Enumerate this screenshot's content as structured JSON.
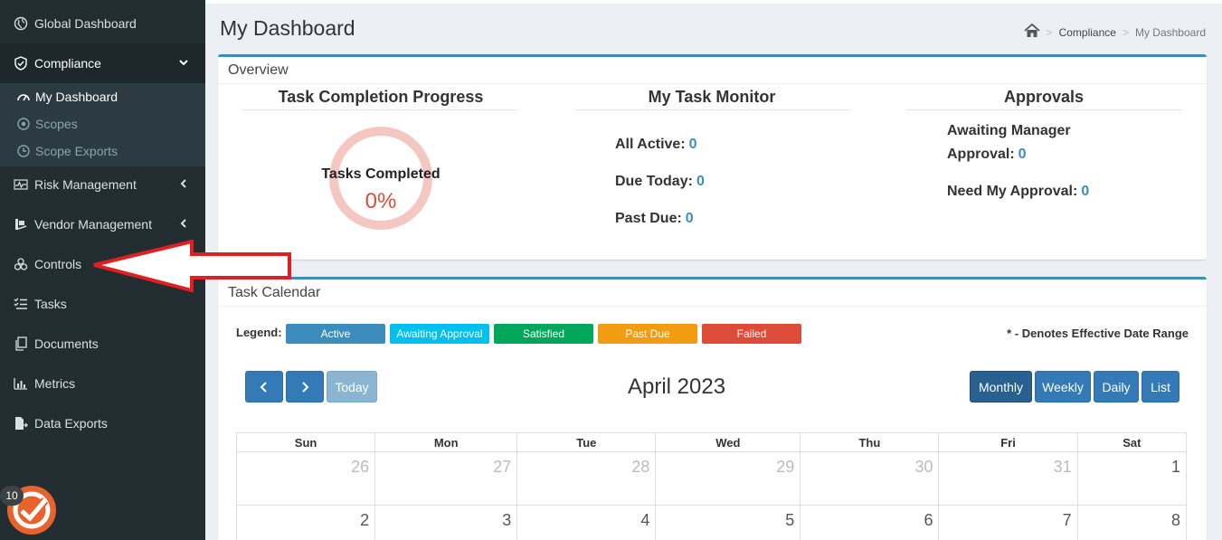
{
  "sidebar": {
    "global_dashboard": "Global Dashboard",
    "compliance": "Compliance",
    "sub": {
      "my_dashboard": "My Dashboard",
      "scopes": "Scopes",
      "scope_exports": "Scope Exports"
    },
    "risk_management": "Risk Management",
    "vendor_management": "Vendor Management",
    "controls": "Controls",
    "tasks": "Tasks",
    "documents": "Documents",
    "metrics": "Metrics",
    "data_exports": "Data Exports",
    "badge": "10"
  },
  "header": {
    "title": "My Dashboard",
    "breadcrumb": [
      "Compliance",
      "My Dashboard"
    ]
  },
  "overview": {
    "title": "Overview",
    "progress": {
      "title": "Task Completion Progress",
      "label": "Tasks Completed",
      "value": "0%",
      "fraction": 0
    },
    "monitor": {
      "title": "My Task Monitor",
      "all_active_label": "All Active:",
      "all_active": "0",
      "due_today_label": "Due Today:",
      "due_today": "0",
      "past_due_label": "Past Due:",
      "past_due": "0"
    },
    "approvals": {
      "title": "Approvals",
      "awaiting_label_1": "Awaiting Manager",
      "awaiting_label_2": "Approval:",
      "awaiting": "0",
      "need_label": "Need My Approval:",
      "need": "0"
    }
  },
  "calendar": {
    "title": "Task Calendar",
    "legend_label": "Legend:",
    "legend": [
      {
        "label": "Active",
        "color": "#3c8dbc"
      },
      {
        "label": "Awaiting Approval",
        "color": "#00c0ef"
      },
      {
        "label": "Satisfied",
        "color": "#00a65a"
      },
      {
        "label": "Past Due",
        "color": "#f39c12"
      },
      {
        "label": "Failed",
        "color": "#dd4b39"
      }
    ],
    "note": "* - Denotes Effective Date Range",
    "today_label": "Today",
    "month": "April 2023",
    "views": [
      "Monthly",
      "Weekly",
      "Daily",
      "List"
    ],
    "days": [
      "Sun",
      "Mon",
      "Tue",
      "Wed",
      "Thu",
      "Fri",
      "Sat"
    ],
    "week1": [
      "26",
      "27",
      "28",
      "29",
      "30",
      "31",
      "1"
    ],
    "week2": [
      "2",
      "3",
      "4",
      "5",
      "6",
      "7",
      "8"
    ]
  }
}
